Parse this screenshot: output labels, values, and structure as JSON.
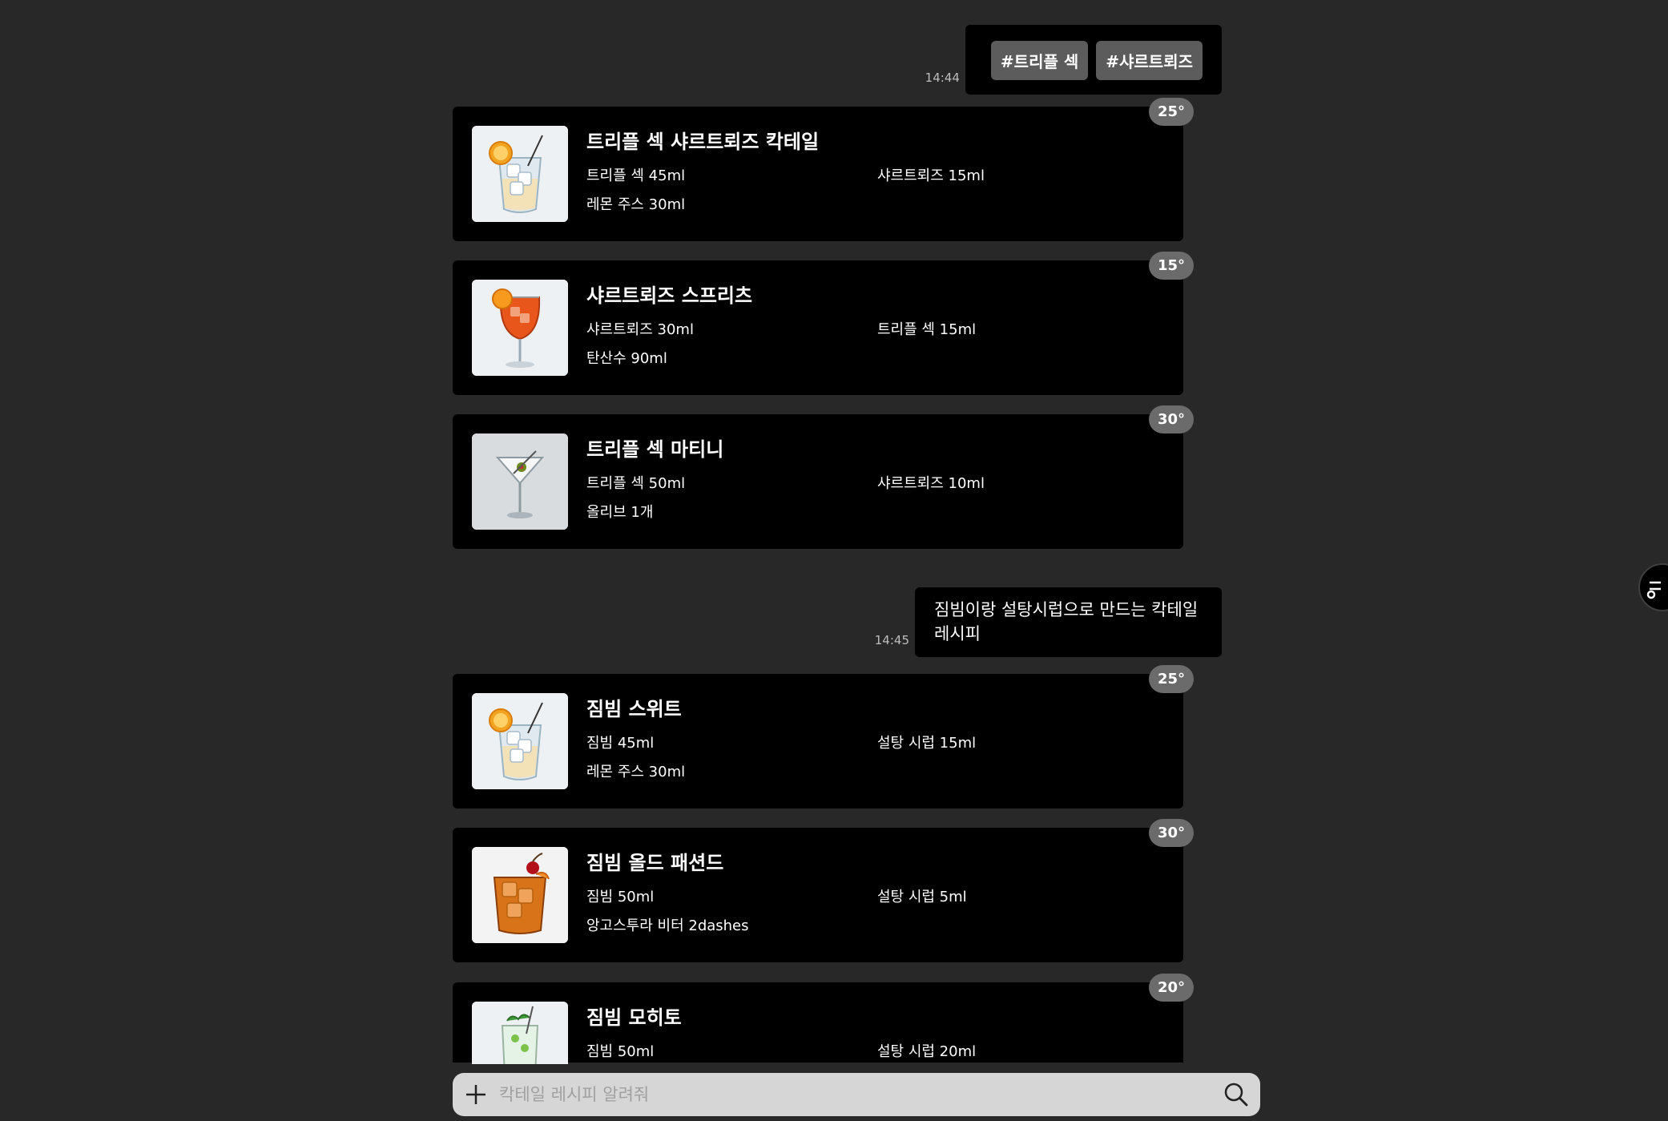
{
  "conversation": {
    "msg1": {
      "time": "14:44",
      "tags": [
        "#트리플 섹",
        "#샤르트뢰즈"
      ]
    },
    "msg2": {
      "time": "14:45",
      "text": "짐빔이랑 설탕시럽으로 만드는 칵테일 레시피"
    }
  },
  "recipes": [
    {
      "name": "트리플 섹 샤르트뢰즈 칵테일",
      "abv": "25°",
      "ingredients": [
        "트리플 섹 45ml",
        "샤르트뢰즈 15ml",
        "레몬 주스 30ml"
      ],
      "glass_icon": "rocks-glass-with-orange-icon"
    },
    {
      "name": "샤르트뢰즈 스프리츠",
      "abv": "15°",
      "ingredients": [
        "샤르트뢰즈 30ml",
        "트리플 섹 15ml",
        "탄산수 90ml"
      ],
      "glass_icon": "spritz-wine-glass-icon"
    },
    {
      "name": "트리플 섹 마티니",
      "abv": "30°",
      "ingredients": [
        "트리플 섹 50ml",
        "샤르트뢰즈 10ml",
        "올리브 1개"
      ],
      "glass_icon": "martini-glass-icon"
    },
    {
      "name": "짐빔 스위트",
      "abv": "25°",
      "ingredients": [
        "짐빔 45ml",
        "설탕 시럽 15ml",
        "레몬 주스 30ml"
      ],
      "glass_icon": "rocks-glass-with-orange-icon"
    },
    {
      "name": "짐빔 올드 패션드",
      "abv": "30°",
      "ingredients": [
        "짐빔 50ml",
        "설탕 시럽 5ml",
        "앙고스투라 비터 2dashes"
      ],
      "glass_icon": "old-fashioned-glass-icon"
    },
    {
      "name": "짐빔 모히토",
      "abv": "20°",
      "ingredients": [
        "짐빔 50ml",
        "설탕 시럽 20ml"
      ],
      "glass_icon": "mojito-highball-glass-icon"
    }
  ],
  "search": {
    "placeholder": "칵테일 레시피 알려줘"
  },
  "icons": {
    "add": "plus-icon",
    "search": "search-icon",
    "side": "filter-icon"
  },
  "colors": {
    "background": "#282828",
    "card": "#000000",
    "badge": "#6b6b6b",
    "tag": "#5c5c5c",
    "input_bar": "#d6d6d6"
  }
}
